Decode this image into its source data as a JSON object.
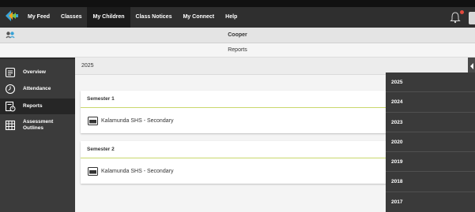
{
  "nav": {
    "items": [
      {
        "label": "My Feed",
        "name": "nav-my-feed",
        "active": false
      },
      {
        "label": "Classes",
        "name": "nav-classes",
        "active": false
      },
      {
        "label": "My Children",
        "name": "nav-my-children",
        "active": true
      },
      {
        "label": "Class Notices",
        "name": "nav-class-notices",
        "active": false
      },
      {
        "label": "My Connect",
        "name": "nav-my-connect",
        "active": false
      },
      {
        "label": "Help",
        "name": "nav-help",
        "active": false
      }
    ],
    "notification_icon": "bell-icon"
  },
  "child": {
    "name": "Cooper"
  },
  "page": {
    "title": "Reports"
  },
  "sidebar": {
    "items": [
      {
        "label": "Overview",
        "icon": "overview-icon",
        "active": false
      },
      {
        "label": "Attendance",
        "icon": "clock-icon",
        "active": false
      },
      {
        "label": "Reports",
        "icon": "reports-icon",
        "active": true
      },
      {
        "label": "Assessment Outlines",
        "icon": "assessment-icon",
        "active": false
      }
    ]
  },
  "main": {
    "selected_year": "2025",
    "semesters": [
      {
        "title": "Semester 1",
        "school": "Kalamunda SHS - Secondary"
      },
      {
        "title": "Semester 2",
        "school": "Kalamunda SHS - Secondary"
      }
    ]
  },
  "year_dropdown": {
    "options": [
      "2025",
      "2024",
      "2023",
      "2020",
      "2019",
      "2018",
      "2017"
    ]
  },
  "colors": {
    "topbar": "#2f2f2f",
    "sidebar": "#3b3b3b",
    "accent_line": "#c9d86d",
    "notification": "#e2493d"
  }
}
